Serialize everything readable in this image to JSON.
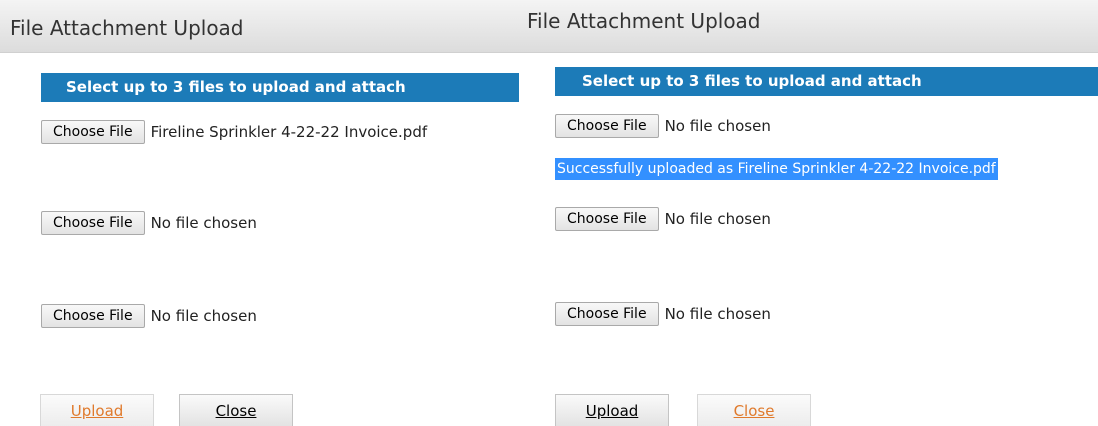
{
  "left_dialog": {
    "title": "File Attachment Upload",
    "header": "Select up to 3 files to upload and attach",
    "rows": [
      {
        "button": "Choose File",
        "file": "Fireline Sprinkler 4-22-22 Invoice.pdf"
      },
      {
        "button": "Choose File",
        "file": "No file chosen"
      },
      {
        "button": "Choose File",
        "file": "No file chosen"
      }
    ],
    "upload_label": "Upload",
    "close_label": "Close"
  },
  "right_dialog": {
    "title": "File Attachment Upload",
    "header": "Select up to 3 files to upload and attach",
    "rows": [
      {
        "button": "Choose File",
        "file": "No file chosen"
      },
      {
        "button": "Choose File",
        "file": "No file chosen"
      },
      {
        "button": "Choose File",
        "file": "No file chosen"
      }
    ],
    "success_message": "Successfully uploaded as Fireline Sprinkler 4-22-22 Invoice.pdf",
    "upload_label": "Upload",
    "close_label": "Close"
  },
  "colors": {
    "header_bg": "#1c7bb8",
    "disabled_text": "#e07a2c",
    "selection_highlight": "#3390ff"
  }
}
